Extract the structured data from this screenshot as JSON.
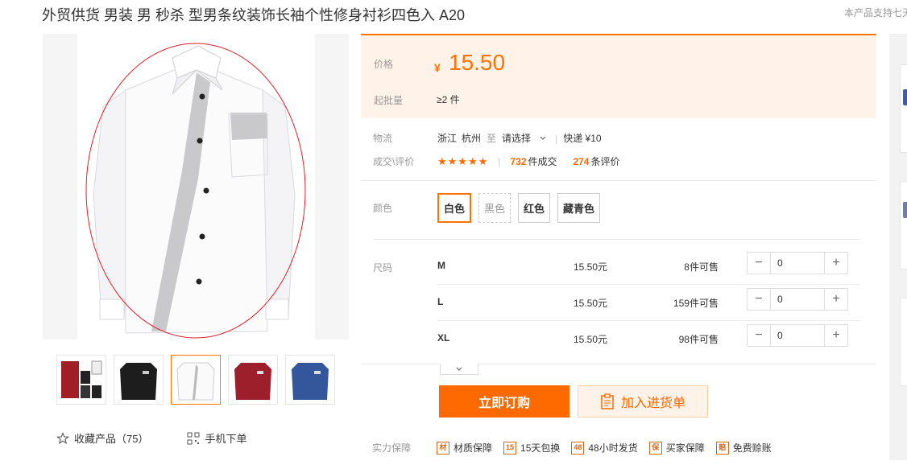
{
  "product": {
    "title": "外贸供货 男装 男 秒杀 型男条纹装饰长袖个性修身衬衫四色入 A20",
    "support_text": "本产品支持七天"
  },
  "gallery": {
    "thumbnails": [
      {
        "name": "thumb-red-black-shirts",
        "active": false
      },
      {
        "name": "thumb-black-shirt",
        "active": false
      },
      {
        "name": "thumb-white-shirt",
        "active": true
      },
      {
        "name": "thumb-red-shirt",
        "active": false
      },
      {
        "name": "thumb-blue-shirt",
        "active": false
      }
    ],
    "favorite_label": "收藏产品（75）",
    "mobile_order_label": "手机下单"
  },
  "pricing": {
    "price_label": "价格",
    "currency": "¥",
    "price": "15.50",
    "min_qty_label": "起批量",
    "min_qty": "≥2 件"
  },
  "logistics": {
    "label": "物流",
    "origin_province": "浙江",
    "origin_city": "杭州",
    "to": "至",
    "destination": "请选择",
    "method": "快递 ¥10"
  },
  "deals": {
    "label": "成交\\评价",
    "stars": "★★★★★",
    "orders_count": "732",
    "orders_suffix": "件成交",
    "reviews_count": "274",
    "reviews_suffix": "条评价"
  },
  "color": {
    "label": "颜色",
    "options": [
      "白色",
      "黑色",
      "红色",
      "藏青色"
    ],
    "selected": "白色"
  },
  "sizes": {
    "label": "尺码",
    "rows": [
      {
        "size": "M",
        "price": "15.50元",
        "stock_num": "8",
        "stock_suffix": "件可售",
        "qty": "0"
      },
      {
        "size": "L",
        "price": "15.50元",
        "stock_num": "159",
        "stock_suffix": "件可售",
        "qty": "0"
      },
      {
        "size": "XL",
        "price": "15.50元",
        "stock_num": "98",
        "stock_suffix": "件可售",
        "qty": "0"
      }
    ]
  },
  "actions": {
    "buy_now": "立即订购",
    "add_to_cart": "加入进货单"
  },
  "guarantees": {
    "label": "实力保障",
    "items": [
      {
        "icon": "材",
        "text": "材质保障"
      },
      {
        "icon": "15",
        "text": "15天包换"
      },
      {
        "icon": "48",
        "text": "48小时发货"
      },
      {
        "icon": "保",
        "text": "买家保障"
      },
      {
        "icon": "赔",
        "text": "免费赊账"
      }
    ]
  },
  "colors_theme": {
    "accent": "#ff7300",
    "price_bg": "#fff2e8"
  }
}
